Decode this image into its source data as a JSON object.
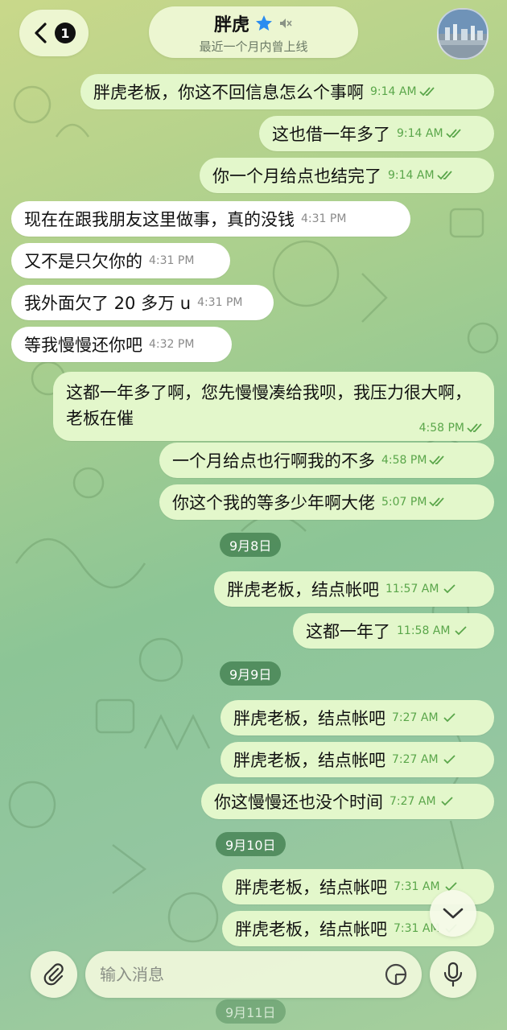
{
  "header": {
    "back_badge": "1",
    "contact_name": "胖虎",
    "status": "最近一个月内曾上线"
  },
  "messages": [
    {
      "dir": "out",
      "text": "胖虎老板，你这不回信息怎么个事啊",
      "time": "9:14 AM",
      "ticks": "double"
    },
    {
      "dir": "out",
      "text": "这也借一年多了",
      "time": "9:14 AM",
      "ticks": "double"
    },
    {
      "dir": "out",
      "text": "你一个月给点也结完了",
      "time": "9:14 AM",
      "ticks": "double"
    },
    {
      "dir": "in",
      "text": "现在在跟我朋友这里做事，真的没钱",
      "time": "4:31 PM"
    },
    {
      "dir": "in",
      "text": "又不是只欠你的",
      "time": "4:31 PM"
    },
    {
      "dir": "in",
      "text": "我外面欠了 20 多万 u",
      "time": "4:31 PM"
    },
    {
      "dir": "in",
      "text": "等我慢慢还你吧",
      "time": "4:32 PM"
    },
    {
      "dir": "out",
      "text": "这都一年多了啊，您先慢慢凑给我呗，我压力很大啊，老板在催",
      "time": "4:58 PM",
      "ticks": "double"
    },
    {
      "dir": "out",
      "text": "一个月给点也行啊我的不多",
      "time": "4:58 PM",
      "ticks": "double"
    },
    {
      "dir": "out",
      "text": "你这个我的等多少年啊大佬",
      "time": "5:07 PM",
      "ticks": "double"
    },
    {
      "dir": "out",
      "text": "胖虎老板，结点帐吧",
      "time": "11:57 AM",
      "ticks": "single"
    },
    {
      "dir": "out",
      "text": "这都一年了",
      "time": "11:58 AM",
      "ticks": "single"
    },
    {
      "dir": "out",
      "text": "胖虎老板，结点帐吧",
      "time": "7:27 AM",
      "ticks": "single"
    },
    {
      "dir": "out",
      "text": "胖虎老板，结点帐吧",
      "time": "7:27 AM",
      "ticks": "single"
    },
    {
      "dir": "out",
      "text": "你这慢慢还也没个时间",
      "time": "7:27 AM",
      "ticks": "single"
    },
    {
      "dir": "out",
      "text": "胖虎老板，结点帐吧",
      "time": "7:31 AM",
      "ticks": "single"
    },
    {
      "dir": "out",
      "text": "胖虎老板，结点帐吧",
      "time": "7:31 AM",
      "ticks": "single"
    }
  ],
  "date_separators": [
    "9月8日",
    "9月9日",
    "9月10日",
    "9月11日"
  ],
  "composer": {
    "placeholder": "输入消息"
  },
  "colors": {
    "outgoing_bubble": "#e3f7cb",
    "incoming_bubble": "#ffffff",
    "tick_green": "#5aa64a",
    "date_chip": "#3a7848",
    "star_blue": "#2a8cf0"
  },
  "icons": [
    "back-chevron-icon",
    "star-icon",
    "mute-icon",
    "attach-icon",
    "sticker-icon",
    "mic-icon",
    "chevron-down-icon"
  ]
}
